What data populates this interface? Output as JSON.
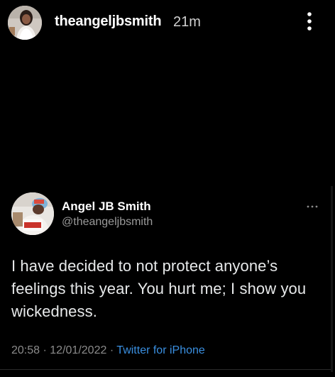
{
  "story": {
    "username": "theangeljbsmith",
    "time": "21m"
  },
  "tweet": {
    "name": "Angel JB Smith",
    "handle": "@theangeljbsmith",
    "text": "I have decided to not protect anyone’s feelings this year. You hurt me; I show you wickedness.",
    "time": "20:58",
    "date": "12/01/2022",
    "separator": "·",
    "source": "Twitter for iPhone"
  },
  "icons": {
    "story_menu": "more-vertical-icon",
    "tweet_menu": "more-horizontal-icon"
  },
  "colors": {
    "background": "#000000",
    "link": "#3a8fe0",
    "secondary_text": "#9a9a9a"
  }
}
